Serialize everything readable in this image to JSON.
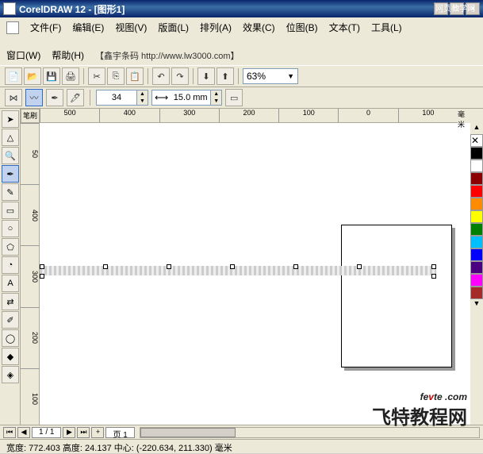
{
  "title": "CorelDRAW 12 - [图形1]",
  "top_logo": "网页教学网",
  "menu": {
    "file": "文件(F)",
    "edit": "编辑(E)",
    "view": "视图(V)",
    "layout": "版面(L)",
    "arrange": "排列(A)",
    "effects": "效果(C)",
    "bitmap": "位图(B)",
    "text": "文本(T)",
    "tools": "工具(L)",
    "window": "窗口(W)",
    "help": "帮助(H)",
    "barcode": "【鑫宇条码 http://www.lw3000.com】"
  },
  "toolbar": {
    "zoom": "63%"
  },
  "prop": {
    "stroke": "34",
    "width": "15.0 mm"
  },
  "ruler": {
    "corner": "笔刷",
    "h": [
      "500",
      "400",
      "300",
      "200",
      "100",
      "0",
      "100"
    ],
    "hunit": "毫米",
    "v": [
      "50",
      "400",
      "300",
      "200",
      "100"
    ]
  },
  "colors": [
    "#000",
    "#fff",
    "#8b0000",
    "#ff0000",
    "#ff8c00",
    "#ffff00",
    "#008000",
    "#00bfff",
    "#0000ff",
    "#4b0082",
    "#ff00ff",
    "#a52a2a"
  ],
  "pager": {
    "label": "1 / 1",
    "tab": "页 1"
  },
  "status": "宽度: 772.403   高度: 24.137  中心: (-220.634, 211.330)  毫米",
  "wm1a": "fe",
  "wm1b": "v",
  "wm1c": "te",
  "wm1d": " .com",
  "wm2": "飞特教程网"
}
